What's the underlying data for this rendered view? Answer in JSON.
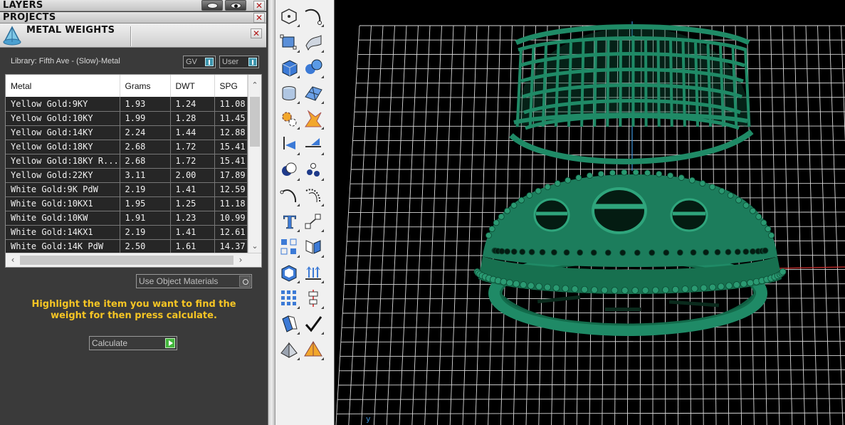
{
  "panels": {
    "layers_title": "LAYERS",
    "projects_title": "PROJECTS",
    "metal_weights_title": "METAL WEIGHTS"
  },
  "library": {
    "label": "Library: Fifth Ave - (Slow)-Metal",
    "gv_label": "GV",
    "user_label": "User"
  },
  "table": {
    "columns": [
      "Metal",
      "Grams",
      "DWT",
      "SPG"
    ],
    "rows": [
      [
        "Yellow Gold:9KY",
        "1.93",
        "1.24",
        "11.08"
      ],
      [
        "Yellow Gold:10KY",
        "1.99",
        "1.28",
        "11.45"
      ],
      [
        "Yellow Gold:14KY",
        "2.24",
        "1.44",
        "12.88"
      ],
      [
        "Yellow Gold:18KY",
        "2.68",
        "1.72",
        "15.41"
      ],
      [
        "Yellow Gold:18KY R...",
        "2.68",
        "1.72",
        "15.41"
      ],
      [
        "Yellow Gold:22KY",
        "3.11",
        "2.00",
        "17.89"
      ],
      [
        "White Gold:9K PdW",
        "2.19",
        "1.41",
        "12.59"
      ],
      [
        "White Gold:10KX1",
        "1.95",
        "1.25",
        "11.18"
      ],
      [
        "White Gold:10KW",
        "1.91",
        "1.23",
        "10.99"
      ],
      [
        "White Gold:14KX1",
        "2.19",
        "1.41",
        "12.61"
      ],
      [
        "White Gold:14K PdW",
        "2.50",
        "1.61",
        "14.37"
      ]
    ]
  },
  "materials_dropdown": {
    "value": "Use Object Materials"
  },
  "hint_text": "Highlight the item you want to find the weight for then press calculate.",
  "calculate_button": {
    "label": "Calculate"
  },
  "colors": {
    "accent_yellow": "#f6c524",
    "model_green": "#1f8a66",
    "calc_green": "#42b53b",
    "toggle_blue": "#3d95ad"
  },
  "toolbar_icons": [
    [
      "polygon-icon",
      "curve-icon"
    ],
    [
      "deform-cage-icon",
      "surface-icon"
    ],
    [
      "box-primitive-icon",
      "sphere-icon"
    ],
    [
      "cylinder-icon",
      "mesh-icon"
    ],
    [
      "gears-icon",
      "burst-icon"
    ],
    [
      "split-icon",
      "trim-icon"
    ],
    [
      "boolean-icon",
      "particles-icon"
    ],
    [
      "arc-curve-icon",
      "offset-curve-icon"
    ],
    [
      "text-icon",
      "scale-icon"
    ],
    [
      "array-icon",
      "mirror-icon"
    ],
    [
      "shell-icon",
      "extrude-arrows-icon"
    ],
    [
      "grid-array-icon",
      "align-icon"
    ],
    [
      "pipe-icon",
      "check-icon"
    ],
    [
      "facet-shape-icon",
      "gem-icon"
    ]
  ]
}
